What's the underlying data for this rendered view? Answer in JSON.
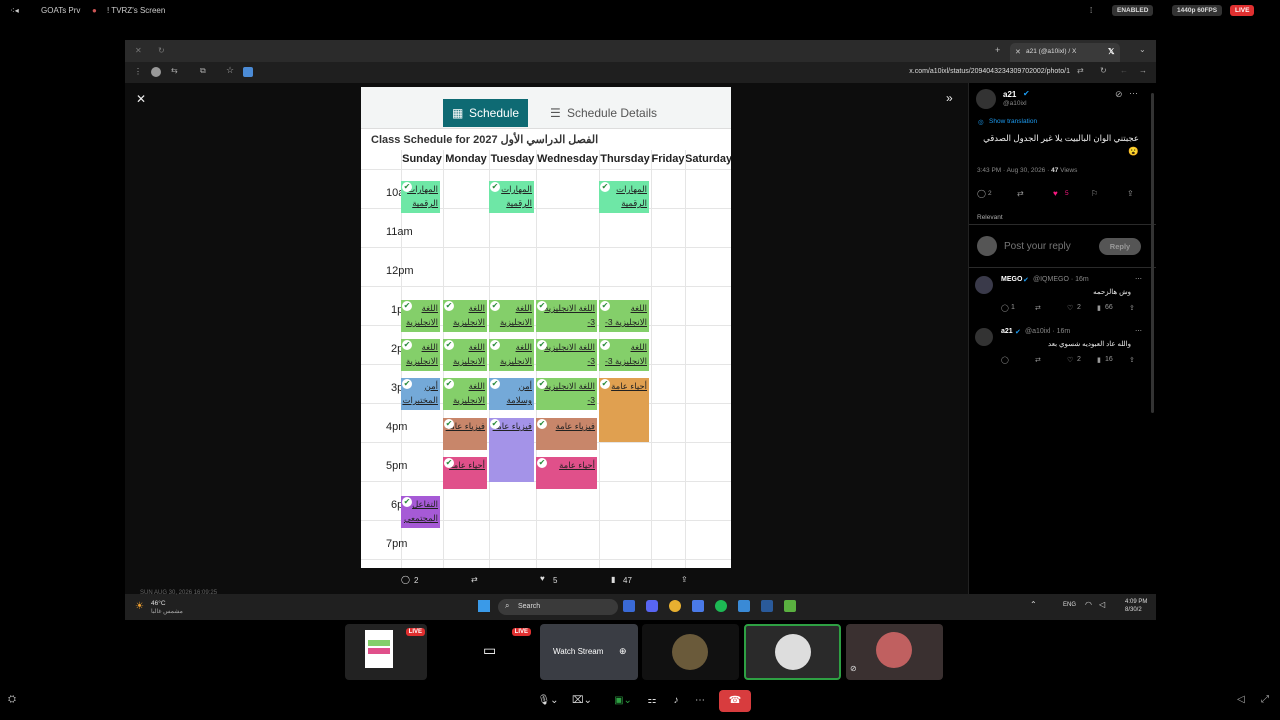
{
  "topbar": {
    "server": "GOATs Prv",
    "stream_name": "! TVRZ's Screen",
    "badge_enabled": "ENABLED",
    "badge_quality": "1440p 60FPS",
    "badge_live": "LIVE"
  },
  "browser": {
    "tab_title": "a21 (@a10ixl) / X",
    "url": "x.com/a10ixl/status/2094043234309702002/photo/1"
  },
  "schedule": {
    "tab_schedule": "Schedule",
    "tab_details": "Schedule Details",
    "title": "Class Schedule for 2027 الفصل الدراسي الأول",
    "days": [
      "Sunday",
      "Monday",
      "Tuesday",
      "Wednesday",
      "Thursday",
      "Friday",
      "Saturday"
    ],
    "times": [
      "10a",
      "11am",
      "12pm",
      "1p",
      "2p",
      "3p",
      "4pm",
      "5pm",
      "6p",
      "7pm"
    ],
    "events": [
      {
        "label": "المهارات الرقمية",
        "color": "#6ee7a6"
      },
      {
        "label": "المهارات الرقمية",
        "color": "#6ee7a6"
      },
      {
        "label": "المهارات الرقمية",
        "color": "#6ee7a6"
      },
      {
        "label": "اللغة الانجليزية 3-",
        "color": "#84cf6a"
      },
      {
        "label": "اللغة الانجليزية 3-",
        "color": "#84cf6a"
      },
      {
        "label": "اللغة الانجليزية 3-",
        "color": "#84cf6a"
      },
      {
        "label": "اللغة الانجليزية 3-",
        "color": "#84cf6a"
      },
      {
        "label": "اللغة الانجليزية 3-",
        "color": "#84cf6a"
      },
      {
        "label": "اللغة الانجليزية 3-",
        "color": "#84cf6a"
      },
      {
        "label": "اللغة الانجليزية 3-",
        "color": "#84cf6a"
      },
      {
        "label": "اللغة الانجليزية 3-",
        "color": "#84cf6a"
      },
      {
        "label": "اللغة الانجليزية 3-",
        "color": "#84cf6a"
      },
      {
        "label": "اللغة الانجليزية 3-",
        "color": "#84cf6a"
      },
      {
        "label": "أمن المختبرات",
        "color": "#74a9d8"
      },
      {
        "label": "اللغة الانجليزية 3-",
        "color": "#84cf6a"
      },
      {
        "label": "أمن وسلامة المختبرات",
        "color": "#74a9d8"
      },
      {
        "label": "اللغة الانجليزية 3-",
        "color": "#84cf6a"
      },
      {
        "label": "أحياء عامة",
        "color": "#e0a050"
      },
      {
        "label": "فيزياء عامة",
        "color": "#c8866a"
      },
      {
        "label": "فيزياء عامة",
        "color": "#a493e8"
      },
      {
        "label": "فيزياء عامة",
        "color": "#c8866a"
      },
      {
        "label": "أحياء عامة",
        "color": "#e0508a"
      },
      {
        "label": "أحياء عامة",
        "color": "#e0508a"
      },
      {
        "label": "التفاعل المجتمعي 1",
        "color": "#a65ad6"
      }
    ]
  },
  "viewer_bar": {
    "replies": "2",
    "likes": "5",
    "views": "47"
  },
  "tweet": {
    "name": "a21",
    "handle": "@a10ixl",
    "show_translation": "Show translation",
    "text": "عجبتني الوان البالبيت يلا غير الجدول الصدقي😮",
    "timestamp": "3:43 PM · Aug 30, 2026 · ",
    "views_count": "47",
    "views_label": " Views",
    "reply_count": "2",
    "like_count": "5",
    "relevant": "Relevant",
    "reply_placeholder": "Post your reply",
    "reply_button": "Reply"
  },
  "replies": [
    {
      "name": "MEGO",
      "handle": "@IQMEGO · 16m",
      "text": "وش هالزحمه",
      "replies": "1",
      "likes": "2",
      "views": "66"
    },
    {
      "name": "a21",
      "handle": "@a10ixl · 16m",
      "text": "والله عاد العبوديه شسوي بعد",
      "replies": "",
      "likes": "2",
      "views": "16"
    }
  ],
  "taskbar": {
    "weather_temp": "46°C",
    "weather_desc": "مشمس غالبا",
    "search": "Search",
    "lang": "ENG",
    "clock_time": "4:09 PM",
    "clock_date": "8/30/2"
  },
  "screen_overlay_date": "SUN AUG 30, 2026 16:09:25",
  "call": {
    "watch_stream": "Watch Stream",
    "live": "LIVE"
  }
}
